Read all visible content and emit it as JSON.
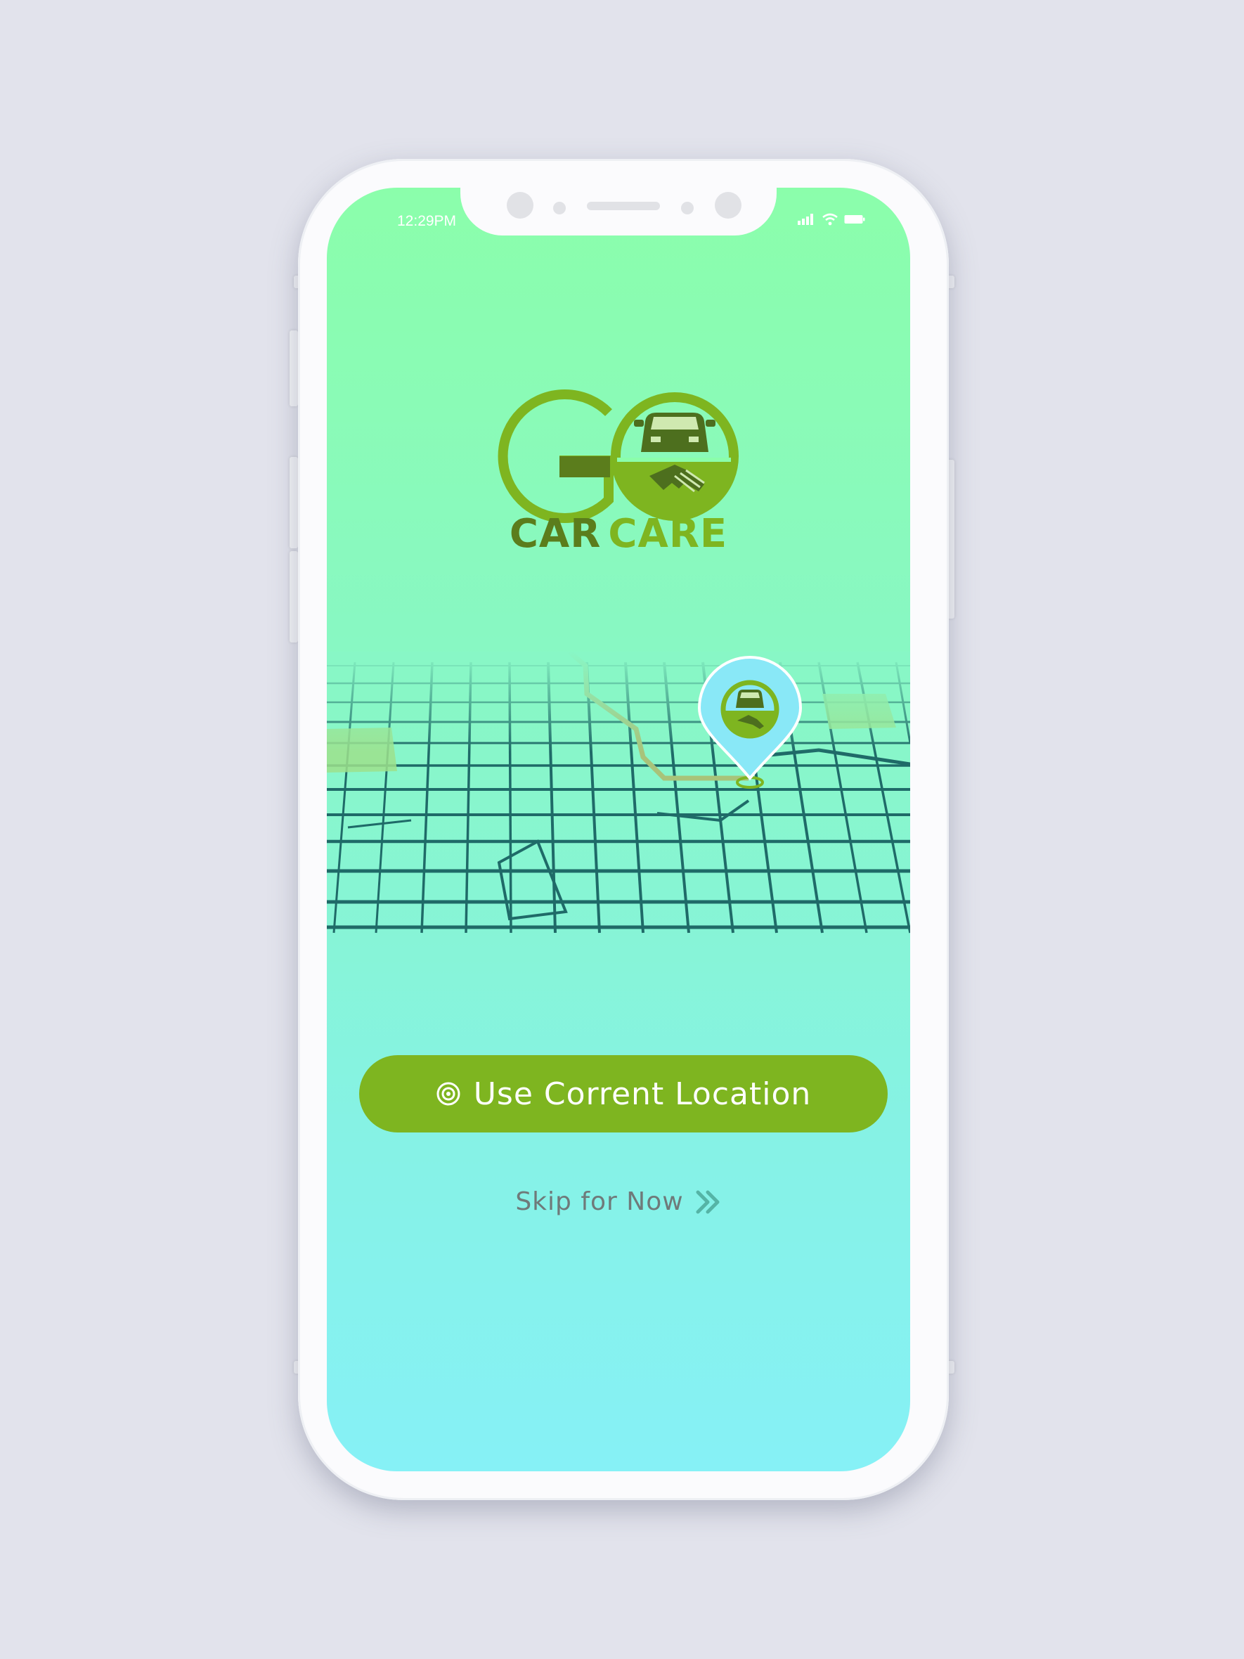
{
  "status_bar": {
    "time": "12:29PM",
    "icons": [
      "signal-icon",
      "wifi-icon",
      "battery-icon"
    ]
  },
  "brand": {
    "logo_word": "GO",
    "car": "CAR",
    "care": "CARE",
    "colors": {
      "light_green": "#7eb520",
      "dark_green": "#5b7d1c"
    }
  },
  "map": {
    "pin_icon": "location-pin-icon"
  },
  "primary_button": {
    "label": "Use Corrent Location",
    "icon": "target-icon",
    "color": "#7eb520"
  },
  "skip_link": {
    "label": "Skip for Now",
    "icon": "double-chevron-right-icon"
  }
}
